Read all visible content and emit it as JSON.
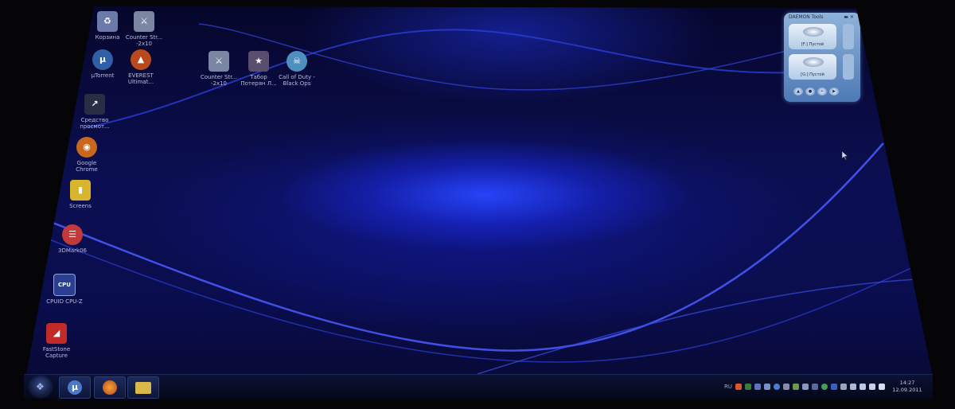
{
  "desktop": {
    "icons": [
      {
        "id": "recycle-bin",
        "label": "Корзина",
        "icon": "recycle-bin-icon",
        "color": "#6b7aa8"
      },
      {
        "id": "counter-strike-1",
        "label": "Counter Str...\n-2x10",
        "icon": "soldiers-icon",
        "color": "#7b86a3"
      },
      {
        "id": "utorrent",
        "label": "µTorrent",
        "icon": "utorrent-icon",
        "color": "#2f5fa6"
      },
      {
        "id": "everest",
        "label": "EVEREST\nUltimat...",
        "icon": "everest-icon",
        "color": "#b84a1d"
      },
      {
        "id": "counter-strike-2",
        "label": "Counter Str...\n-2x10",
        "icon": "soldiers-icon",
        "color": "#7b86a3"
      },
      {
        "id": "taboo",
        "label": "Табор\nПотерян Л...",
        "icon": "game-icon",
        "color": "#5a4e6e"
      },
      {
        "id": "call-of-duty",
        "label": "Call of Duty -\nBlack Ops",
        "icon": "skull-icon",
        "color": "#4e8fbf"
      },
      {
        "id": "shortcut",
        "label": "Средство\nпросмот...",
        "icon": "shortcut-icon",
        "color": "#2a2e44"
      },
      {
        "id": "google-chrome",
        "label": "Google\nChrome",
        "icon": "chrome-icon",
        "color": "#c9681d"
      },
      {
        "id": "screens",
        "label": "Screens",
        "icon": "folder-icon",
        "color": "#d7b52e"
      },
      {
        "id": "3dmark",
        "label": "3DMark06",
        "icon": "3dmark-icon",
        "color": "#c23a3a"
      },
      {
        "id": "cpu-z",
        "label": "CPUID CPU-Z",
        "icon": "cpu-z-icon",
        "color": "#2a3f8f"
      },
      {
        "id": "faststone",
        "label": "FastStone\nCapture",
        "icon": "faststone-icon",
        "color": "#c22a2a"
      }
    ]
  },
  "gadget": {
    "title": "DAEMON Tools",
    "slot1_label": "[F:] Пустой",
    "slot2_label": "[G:] Пустой",
    "buttons": [
      "▲",
      "●",
      "+",
      "▶"
    ]
  },
  "taskbar": {
    "start_icon": "windows-logo-icon",
    "pinned": [
      {
        "id": "utorrent",
        "icon": "utorrent-icon",
        "glyph": "µ",
        "color": "#4a79c8"
      },
      {
        "id": "firefox",
        "icon": "firefox-icon",
        "glyph": "●",
        "color": "#d9762a"
      },
      {
        "id": "explorer",
        "icon": "folder-icon",
        "glyph": "▬",
        "color": "#d9b84a"
      }
    ],
    "language": "RU",
    "time": "14:27",
    "date": "12.09.2011"
  },
  "colors": {
    "wallpaper_glow": "#2846ff",
    "wallpaper_dark": "#06062a",
    "taskbar": "#0b1233"
  }
}
